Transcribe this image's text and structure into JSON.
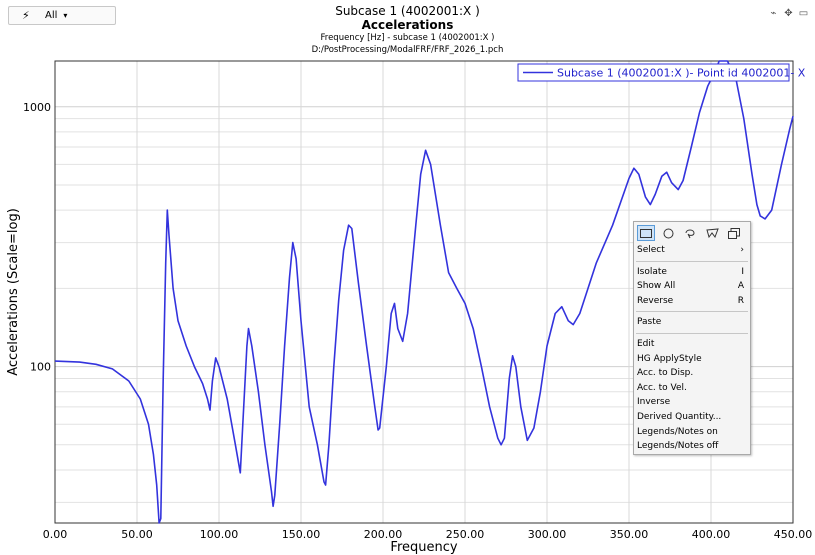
{
  "toolbar": {
    "filter_label": "All"
  },
  "header": {
    "title": "Subcase 1 (4002001:X )",
    "subtitle": "Accelerations",
    "info": "Frequency [Hz] - subcase 1 (4002001:X )",
    "file": "D:/PostProcessing/ModalFRF/FRF_2026_1.pch"
  },
  "chart_data": {
    "type": "line",
    "title": "Accelerations",
    "xlabel": "Frequency",
    "ylabel": "Accelerations (Scale=log)",
    "xlim": [
      0,
      450
    ],
    "ylim": [
      25,
      1500
    ],
    "yscale": "log",
    "grid": true,
    "legend_position": "top-right",
    "x_ticks": [
      "0.00",
      "50.00",
      "100.00",
      "150.00",
      "200.00",
      "250.00",
      "300.00",
      "350.00",
      "400.00",
      "450.00"
    ],
    "y_ticks": [
      "100",
      "1000"
    ],
    "series": [
      {
        "name": "Subcase 1 (4002001:X )- Point id 4002001- X",
        "color": "#3333dd",
        "points": [
          [
            0,
            105
          ],
          [
            15,
            104
          ],
          [
            25,
            102
          ],
          [
            35,
            98
          ],
          [
            45,
            88
          ],
          [
            52,
            75
          ],
          [
            57,
            60
          ],
          [
            60,
            46
          ],
          [
            62,
            35
          ],
          [
            63.5,
            25
          ],
          [
            64.5,
            26
          ],
          [
            66,
            90
          ],
          [
            67.5,
            250
          ],
          [
            68.5,
            400
          ],
          [
            69.5,
            320
          ],
          [
            72,
            200
          ],
          [
            75,
            150
          ],
          [
            80,
            120
          ],
          [
            85,
            100
          ],
          [
            90,
            86
          ],
          [
            93,
            75
          ],
          [
            94.5,
            68
          ],
          [
            96,
            88
          ],
          [
            98,
            108
          ],
          [
            100,
            100
          ],
          [
            105,
            75
          ],
          [
            110,
            50
          ],
          [
            113,
            39
          ],
          [
            114.5,
            60
          ],
          [
            117,
            120
          ],
          [
            118,
            140
          ],
          [
            120,
            120
          ],
          [
            124,
            80
          ],
          [
            128,
            50
          ],
          [
            132,
            33
          ],
          [
            133,
            29
          ],
          [
            134,
            32
          ],
          [
            137,
            60
          ],
          [
            140,
            120
          ],
          [
            143,
            220
          ],
          [
            145,
            300
          ],
          [
            147,
            260
          ],
          [
            150,
            150
          ],
          [
            155,
            70
          ],
          [
            160,
            50
          ],
          [
            164,
            36
          ],
          [
            165,
            35
          ],
          [
            167,
            50
          ],
          [
            170,
            100
          ],
          [
            173,
            180
          ],
          [
            176,
            280
          ],
          [
            179,
            350
          ],
          [
            181,
            340
          ],
          [
            185,
            210
          ],
          [
            190,
            120
          ],
          [
            195,
            70
          ],
          [
            197,
            57
          ],
          [
            198,
            58
          ],
          [
            202,
            100
          ],
          [
            205,
            160
          ],
          [
            207,
            175
          ],
          [
            209,
            140
          ],
          [
            212,
            125
          ],
          [
            215,
            160
          ],
          [
            220,
            350
          ],
          [
            223,
            550
          ],
          [
            226,
            680
          ],
          [
            229,
            600
          ],
          [
            235,
            350
          ],
          [
            240,
            230
          ],
          [
            245,
            200
          ],
          [
            250,
            175
          ],
          [
            255,
            140
          ],
          [
            260,
            100
          ],
          [
            265,
            70
          ],
          [
            270,
            53
          ],
          [
            272,
            50
          ],
          [
            274,
            53
          ],
          [
            277,
            90
          ],
          [
            279,
            110
          ],
          [
            281,
            100
          ],
          [
            284,
            70
          ],
          [
            288,
            52
          ],
          [
            292,
            58
          ],
          [
            296,
            80
          ],
          [
            300,
            120
          ],
          [
            305,
            160
          ],
          [
            309,
            170
          ],
          [
            313,
            150
          ],
          [
            316,
            145
          ],
          [
            320,
            160
          ],
          [
            325,
            200
          ],
          [
            330,
            250
          ],
          [
            340,
            350
          ],
          [
            350,
            530
          ],
          [
            353,
            580
          ],
          [
            356,
            550
          ],
          [
            360,
            450
          ],
          [
            363,
            420
          ],
          [
            366,
            460
          ],
          [
            370,
            540
          ],
          [
            373,
            560
          ],
          [
            376,
            510
          ],
          [
            380,
            480
          ],
          [
            383,
            520
          ],
          [
            388,
            700
          ],
          [
            393,
            950
          ],
          [
            398,
            1200
          ],
          [
            402,
            1350
          ],
          [
            405,
            1500
          ],
          [
            410,
            1500
          ],
          [
            415,
            1300
          ],
          [
            420,
            900
          ],
          [
            425,
            550
          ],
          [
            428,
            420
          ],
          [
            430,
            380
          ],
          [
            433,
            370
          ],
          [
            437,
            400
          ],
          [
            443,
            600
          ],
          [
            448,
            820
          ],
          [
            450,
            920
          ]
        ]
      }
    ]
  },
  "context_menu": {
    "items_group1": [
      {
        "label": "Select",
        "shortcut": "›"
      }
    ],
    "items_group2": [
      {
        "label": "Isolate",
        "shortcut": "I"
      },
      {
        "label": "Show All",
        "shortcut": "A"
      },
      {
        "label": "Reverse",
        "shortcut": "R"
      }
    ],
    "items_group3": [
      {
        "label": "Paste",
        "shortcut": ""
      }
    ],
    "items_group4": [
      {
        "label": "Edit",
        "shortcut": ""
      },
      {
        "label": "HG ApplyStyle",
        "shortcut": ""
      },
      {
        "label": "Acc. to Disp.",
        "shortcut": ""
      },
      {
        "label": "Acc. to Vel.",
        "shortcut": ""
      },
      {
        "label": "Inverse",
        "shortcut": ""
      },
      {
        "label": "Derived Quantity...",
        "shortcut": ""
      },
      {
        "label": "Legends/Notes on",
        "shortcut": ""
      },
      {
        "label": "Legends/Notes off",
        "shortcut": ""
      }
    ]
  }
}
